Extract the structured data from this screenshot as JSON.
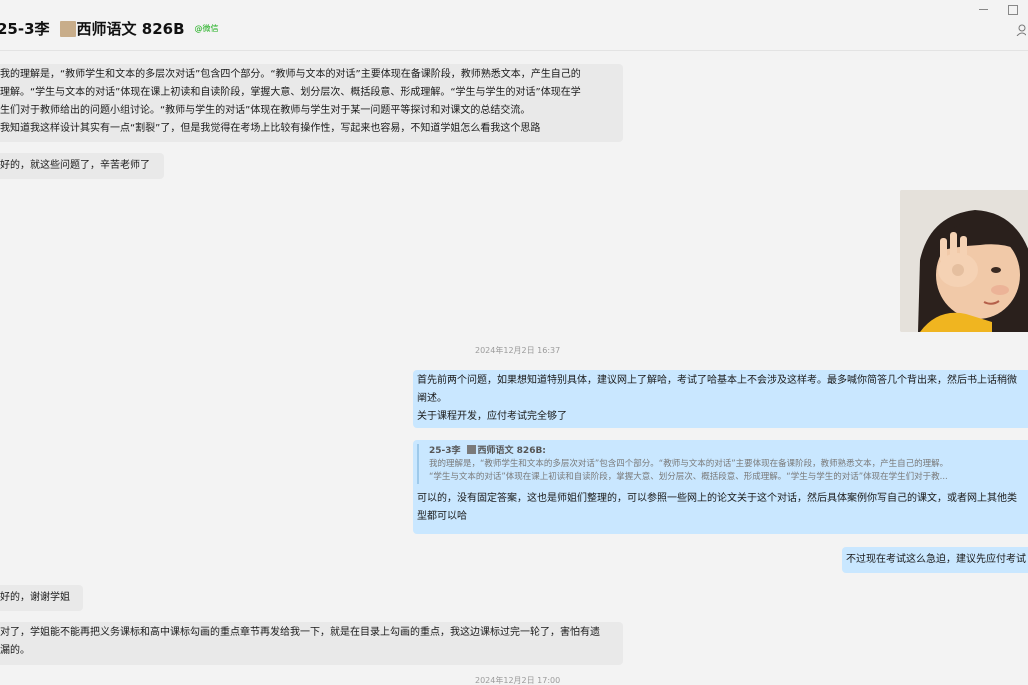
{
  "header": {
    "title_prefix": "25-3李",
    "title_name": "西师语文 826B",
    "wechat_tag": "@微信"
  },
  "messages": {
    "m1": {
      "line1": "我的理解是，“教师学生和文本的多层次对话”包含四个部分。“教师与文本的对话”主要体现在备课阶段，教师熟悉文本，产生自己的",
      "line2": "理解。“学生与文本的对话”体现在课上初读和自读阶段，掌握大意、划分层次、概括段意、形成理解。“学生与学生的对话”体现在学",
      "line3": "生们对于教师给出的问题小组讨论。“教师与学生的对话”体现在教师与学生对于某一问题平等探讨和对课文的总结交流。",
      "line4": "我知道我这样设计其实有一点“割裂”了，但是我觉得在考场上比较有操作性，写起来也容易，不知道学姐怎么看我这个思路"
    },
    "m2": "好的，就这些问题了，辛苦老师了",
    "ts1": "2024年12月2日 16:37",
    "m3": {
      "line1": "首先前两个问题，如果想知道特别具体，建议网上了解哈，考试了哈基本上不会涉及这样考。最多喊你简答几个背出来，然后书上话稍微",
      "line2": "阐述。",
      "line3": "关于课程开发，应付考试完全够了"
    },
    "m4": {
      "quote_prefix": "25-3李",
      "quote_name": "西师语文 826B:",
      "quote_line1": "我的理解是，“教师学生和文本的多层次对话”包含四个部分。“教师与文本的对话”主要体现在备课阶段，教师熟悉文本，产生自己的理解。",
      "quote_line2": "“学生与文本的对话”体现在课上初读和自读阶段，掌握大意、划分层次、概括段意、形成理解。“学生与学生的对话”体现在学生们对于教...",
      "line1": "可以的，没有固定答案，这也是师姐们整理的，可以参照一些网上的论文关于这个对话，然后具体案例你写自己的课文，或者网上其他类",
      "line2": "型都可以哈"
    },
    "m5": "不过现在考试这么急迫，建议先应付考试",
    "m6": "好的，谢谢学姐",
    "m7": {
      "line1": "对了，学姐能不能再把义务课标和高中课标勾画的重点章节再发给我一下，就是在目录上勾画的重点，我这边课标过完一轮了，害怕有遗",
      "line2": "漏的。"
    },
    "ts2": "2024年12月2日 17:00"
  }
}
